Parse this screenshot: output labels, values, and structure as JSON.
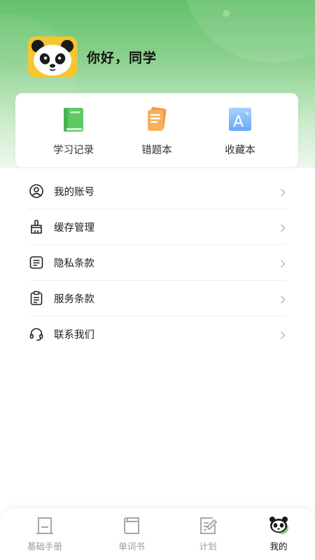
{
  "profile": {
    "greeting": "你好，同学",
    "avatar_icon": "panda-avatar-icon",
    "avatar_bg": "#f7c531"
  },
  "quick_actions": [
    {
      "label": "学习记录",
      "icon": "green-book-icon",
      "color": "#5ec865"
    },
    {
      "label": "错题本",
      "icon": "orange-notebook-icon",
      "color": "#f59a3c"
    },
    {
      "label": "收藏本",
      "icon": "letter-a-card-icon",
      "color": "#7fb6ff"
    }
  ],
  "menu": [
    {
      "label": "我的账号",
      "icon": "user-circle-icon"
    },
    {
      "label": "缓存管理",
      "icon": "broom-icon"
    },
    {
      "label": "隐私条款",
      "icon": "document-lines-icon"
    },
    {
      "label": "服务条款",
      "icon": "clipboard-icon"
    },
    {
      "label": "联系我们",
      "icon": "headset-icon"
    }
  ],
  "tabs": [
    {
      "label": "基础手册",
      "icon": "handbook-icon",
      "active": false
    },
    {
      "label": "单词书",
      "icon": "wordbook-icon",
      "active": false
    },
    {
      "label": "计划",
      "icon": "plan-edit-icon",
      "active": false
    },
    {
      "label": "我的",
      "icon": "panda-tab-icon",
      "active": true
    }
  ],
  "colors": {
    "brand_green": "#63c06a",
    "inactive_tab": "#9a9a9a",
    "active_tab": "#111111"
  }
}
